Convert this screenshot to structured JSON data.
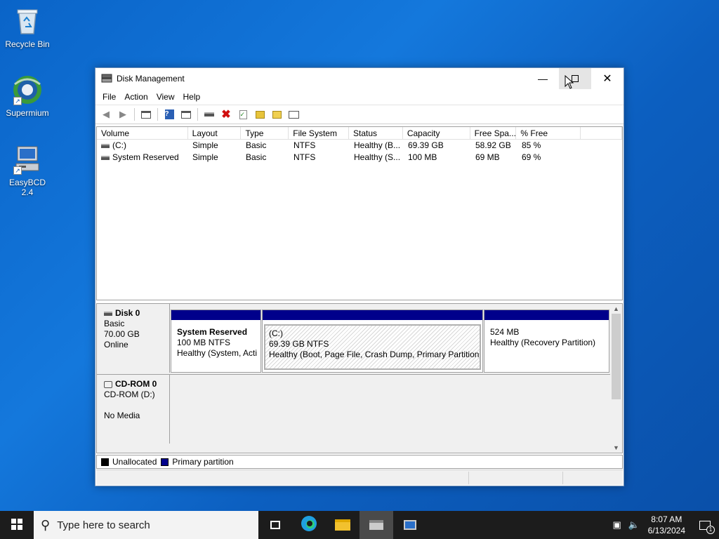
{
  "desktop": {
    "icons": [
      {
        "label": "Recycle Bin"
      },
      {
        "label": "Supermium"
      },
      {
        "label": "EasyBCD 2.4"
      }
    ]
  },
  "window": {
    "title": "Disk Management",
    "menu": [
      "File",
      "Action",
      "View",
      "Help"
    ],
    "columns": [
      "Volume",
      "Layout",
      "Type",
      "File System",
      "Status",
      "Capacity",
      "Free Spa...",
      "% Free"
    ],
    "volumes": [
      {
        "volume": "(C:)",
        "layout": "Simple",
        "type": "Basic",
        "fs": "NTFS",
        "status": "Healthy (B...",
        "capacity": "69.39 GB",
        "free": "58.92 GB",
        "pct": "85 %"
      },
      {
        "volume": "System Reserved",
        "layout": "Simple",
        "type": "Basic",
        "fs": "NTFS",
        "status": "Healthy (S...",
        "capacity": "100 MB",
        "free": "69 MB",
        "pct": "69 %"
      }
    ],
    "disks": [
      {
        "name": "Disk 0",
        "type": "Basic",
        "size": "70.00 GB",
        "state": "Online",
        "partitions": [
          {
            "title": "System Reserved",
            "line1": "100 MB NTFS",
            "line2": "Healthy (System, Acti"
          },
          {
            "title": "(C:)",
            "line1": "69.39 GB NTFS",
            "line2": "Healthy (Boot, Page File, Crash Dump, Primary Partition)"
          },
          {
            "title": "",
            "line1": "524 MB",
            "line2": "Healthy (Recovery Partition)"
          }
        ]
      },
      {
        "name": "CD-ROM 0",
        "type": "CD-ROM (D:)",
        "size": "",
        "state": "No Media"
      }
    ],
    "legend": [
      {
        "label": "Unallocated",
        "color": "#000000"
      },
      {
        "label": "Primary partition",
        "color": "#00008b"
      }
    ]
  },
  "taskbar": {
    "search_placeholder": "Type here to search",
    "time": "8:07 AM",
    "date": "6/13/2024",
    "notification_count": "1"
  }
}
